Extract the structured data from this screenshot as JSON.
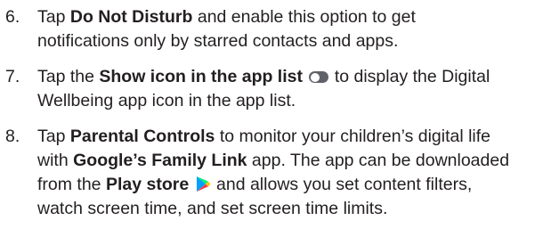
{
  "steps": [
    {
      "number": "6.",
      "line1_pre": "Tap ",
      "line1_bold": "Do Not Disturb",
      "line1_post": " and enable this option to get",
      "line2": "notifications only by starred contacts and apps."
    },
    {
      "number": "7.",
      "line1_pre": "Tap the ",
      "line1_bold": "Show icon in the app list",
      "toggle_icon": "toggle-switch-icon",
      "line1_post": " to display the Digital",
      "line2": "Wellbeing app icon in the app list."
    },
    {
      "number": "8.",
      "line1_pre": "Tap ",
      "line1_bold": "Parental Controls",
      "line1_post": " to monitor your children’s digital life",
      "line2_pre": "with ",
      "line2_bold": "Google’s Family Link",
      "line2_post": " app. The app can be downloaded",
      "line3_pre": "from the ",
      "line3_bold": "Play store",
      "play_icon": "play-store-icon",
      "line3_post": " and allows you set content filters,",
      "line4": "watch screen time, and set screen time limits."
    }
  ],
  "colors": {
    "text": "#231f20",
    "toggle": "#5f6368",
    "play_blue": "#00a0ff",
    "play_green": "#00f076",
    "play_yellow": "#ffc900",
    "play_red": "#ff3a44"
  }
}
